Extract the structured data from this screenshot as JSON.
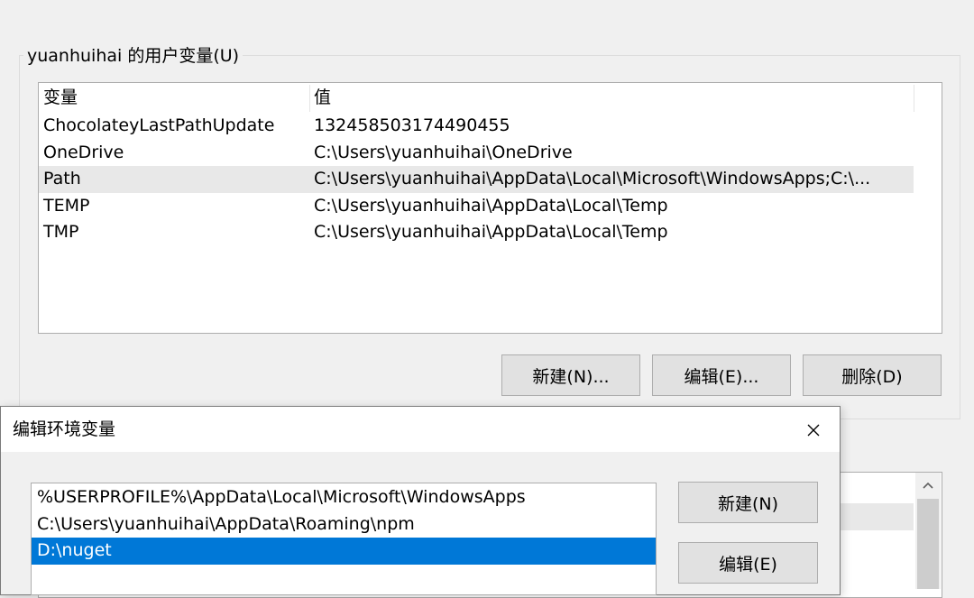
{
  "user_vars": {
    "group_label": "yuanhuihai 的用户变量(U)",
    "columns": {
      "name": "变量",
      "value": "值"
    },
    "rows": [
      {
        "name": "ChocolateyLastPathUpdate",
        "value": "132458503174490455"
      },
      {
        "name": "OneDrive",
        "value": "C:\\Users\\yuanhuihai\\OneDrive"
      },
      {
        "name": "Path",
        "value": "C:\\Users\\yuanhuihai\\AppData\\Local\\Microsoft\\WindowsApps;C:\\..."
      },
      {
        "name": "TEMP",
        "value": "C:\\Users\\yuanhuihai\\AppData\\Local\\Temp"
      },
      {
        "name": "TMP",
        "value": "C:\\Users\\yuanhuihai\\AppData\\Local\\Temp"
      }
    ],
    "selected_index": 2,
    "buttons": {
      "new": "新建(N)...",
      "edit": "编辑(E)...",
      "delete": "删除(D)"
    }
  },
  "edit_dialog": {
    "title": "编辑环境变量",
    "close_glyph": "✕",
    "paths": [
      "%USERPROFILE%\\AppData\\Local\\Microsoft\\WindowsApps",
      "C:\\Users\\yuanhuihai\\AppData\\Roaming\\npm",
      "D:\\nuget"
    ],
    "selected_index": 2,
    "buttons": {
      "new": "新建(N)",
      "edit": "编辑(E)"
    }
  },
  "icons": {
    "close": "close-icon",
    "scroll_up": "scroll-up-arrow-icon"
  },
  "colors": {
    "selection_blue": "#0078d7",
    "row_highlight": "#e8e8e8",
    "button_face": "#e1e1e1"
  }
}
